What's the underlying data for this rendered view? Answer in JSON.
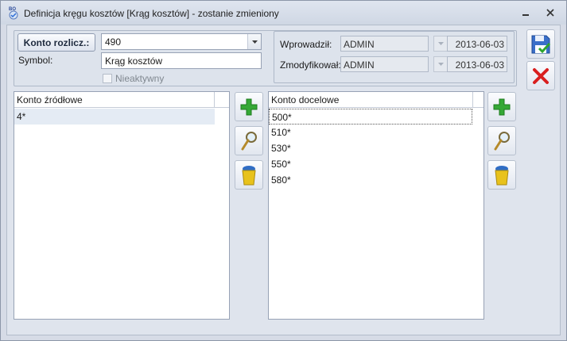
{
  "window": {
    "title": "Definicja kręgu kosztów [Krąg kosztów] - zostanie zmieniony",
    "app_icon": "bo-icon",
    "minimize_icon": "minimize-icon",
    "close_icon": "close-icon"
  },
  "form": {
    "konto_button": "Konto rozlicz.:",
    "konto_value": "490",
    "symbol_label": "Symbol:",
    "symbol_value": "Krąg kosztów",
    "inactive_label": "Nieaktywny",
    "inactive_checked": false
  },
  "audit": {
    "entered_label": "Wprowadził:",
    "entered_user": "ADMIN",
    "entered_date": "2013-06-03",
    "modified_label": "Zmodyfikował:",
    "modified_user": "ADMIN",
    "modified_date": "2013-06-03"
  },
  "source_list": {
    "header": "Konto źródłowe",
    "rows": [
      "4*"
    ]
  },
  "target_list": {
    "header": "Konto docelowe",
    "rows": [
      "500*",
      "510*",
      "530*",
      "550*",
      "580*"
    ]
  },
  "buttons": {
    "add_icon": "plus-icon",
    "preview_icon": "magnifier-icon",
    "delete_icon": "trash-icon",
    "save_icon": "save-icon",
    "cancel_icon": "cancel-icon"
  },
  "colors": {
    "add": "#2ea52e",
    "cancel": "#d91f1f",
    "accent": "#2b6bd6"
  }
}
